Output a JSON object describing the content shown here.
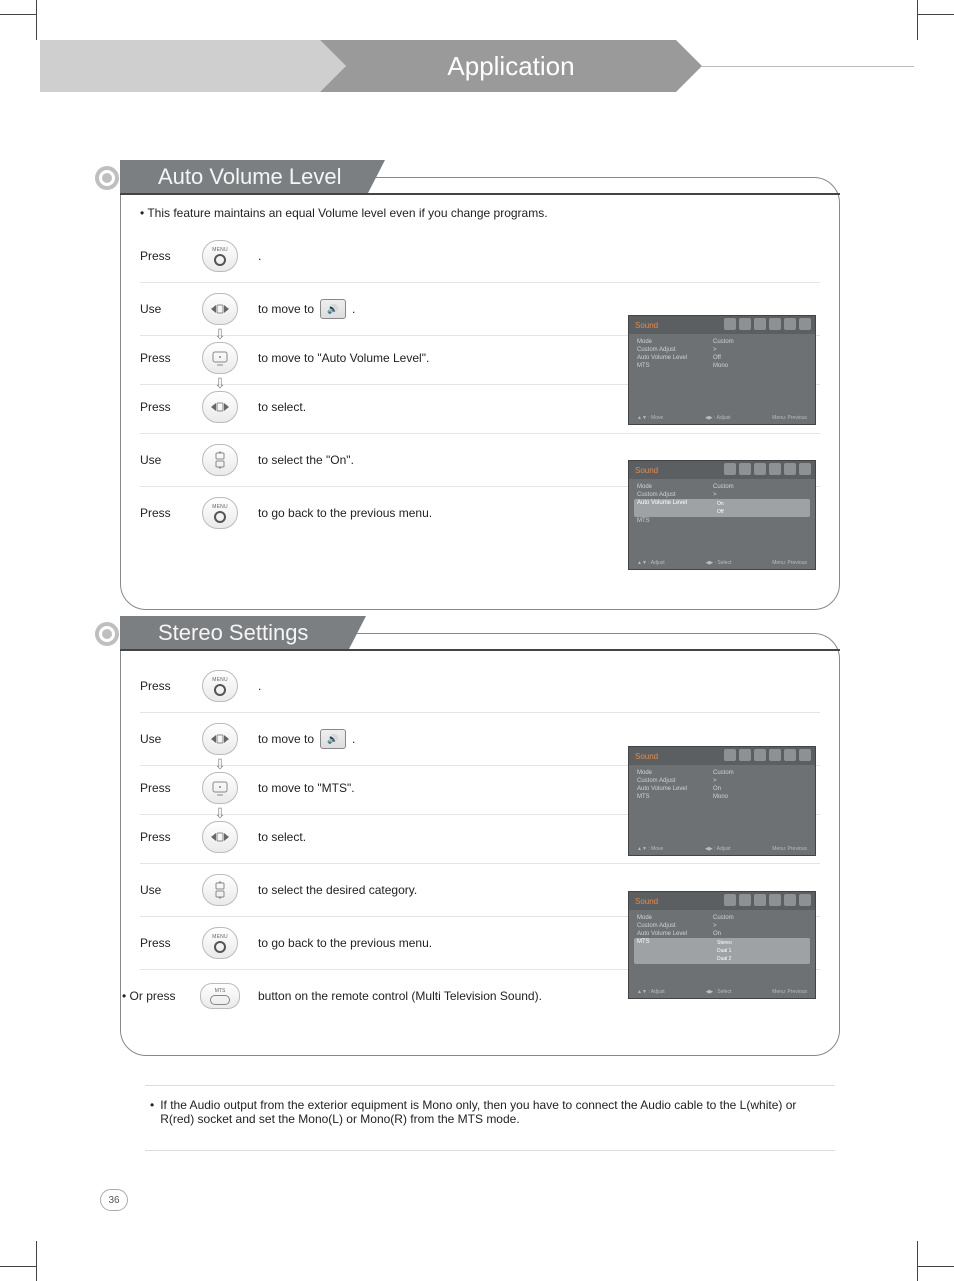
{
  "header": {
    "title": "Application"
  },
  "section1": {
    "title": "Auto Volume Level",
    "intro": "This feature maintains an equal Volume level even if you change programs.",
    "steps": {
      "s1": {
        "verb": "Press",
        "desc": "."
      },
      "s2": {
        "verb": "Use",
        "desc_pre": "to move to",
        "desc_post": "."
      },
      "s3": {
        "verb": "Press",
        "desc": "to move to  \"Auto Volume Level\"."
      },
      "s4": {
        "verb": "Press",
        "desc": "to select."
      },
      "s5": {
        "verb": "Use",
        "desc": "to select the \"On\"."
      },
      "s6": {
        "verb": "Press",
        "desc": "to go back to the previous menu."
      }
    }
  },
  "section2": {
    "title": "Stereo Settings",
    "steps": {
      "s1": {
        "verb": "Press",
        "desc": "."
      },
      "s2": {
        "verb": "Use",
        "desc_pre": "to move to",
        "desc_post": "."
      },
      "s3": {
        "verb": "Press",
        "desc": "to move to  \"MTS\"."
      },
      "s4": {
        "verb": "Press",
        "desc": "to select."
      },
      "s5": {
        "verb": "Use",
        "desc": "to select the desired category."
      },
      "s6": {
        "verb": "Press",
        "desc": "to go back to the previous menu."
      }
    },
    "or": {
      "prefix": "• Or press",
      "suffix": "button on the remote control (Multi Television Sound)."
    },
    "footnote": "If the Audio output from the exterior equipment is Mono only, then you have to connect the Audio cable to the L(white) or R(red) socket and set the Mono(L) or Mono(R) from the MTS mode."
  },
  "buttons": {
    "menu": "MENU",
    "mts": "MTS"
  },
  "soundIconHint": "🔊",
  "osd": {
    "title": "Sound",
    "mode_k": "Mode",
    "mode_v": "Custom",
    "custom_k": "Custom Adjust",
    "custom_v": ">",
    "avl_k": "Auto Volume Level",
    "avl_v_off": "Off",
    "avl_v_on": "On",
    "mts_k": "MTS",
    "mts_v": "Mono",
    "opt_on": "On",
    "opt_off": "Off",
    "opt_stereo": "Stereo",
    "opt_dual1": "Dual 1",
    "opt_dual2": "Dual 2",
    "foot_move": "▲▼ : Move",
    "foot_adjust": "◀▶ : Adjust",
    "foot_menu": "Menu: Previous",
    "foot_select": "◀▶ : Select",
    "foot_adjust2": "▲▼ : Adjust"
  },
  "pageNumber": "36"
}
